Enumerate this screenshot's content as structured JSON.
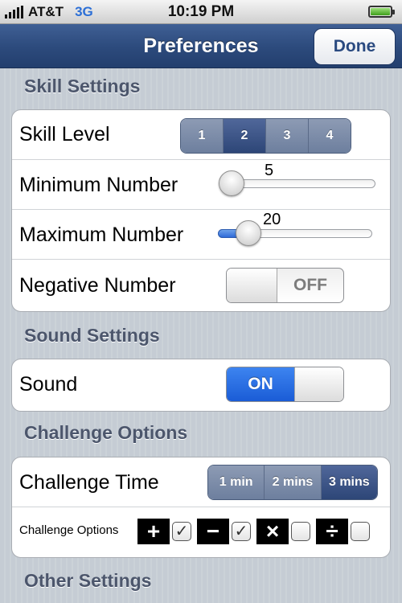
{
  "status_bar": {
    "carrier": "AT&T",
    "network": "3G",
    "time": "10:19 PM",
    "battery_level": 1.0
  },
  "nav": {
    "title": "Preferences",
    "done_label": "Done"
  },
  "sections": {
    "skill": "Skill Settings",
    "sound": "Sound Settings",
    "challenge": "Challenge Options",
    "other": "Other Settings"
  },
  "skill": {
    "level_label": "Skill Level",
    "levels": [
      "1",
      "2",
      "3",
      "4"
    ],
    "selected_level": "2",
    "min_label": "Minimum Number",
    "min_value": "5",
    "min_fraction": 0.07,
    "max_label": "Maximum Number",
    "max_value": "20",
    "max_fraction": 0.2,
    "negative_label": "Negative Number",
    "negative_state": "OFF"
  },
  "sound": {
    "label": "Sound",
    "state": "ON"
  },
  "challenge": {
    "time_label": "Challenge Time",
    "times": [
      "1 min",
      "2 mins",
      "3 mins"
    ],
    "selected_time": "3 mins",
    "options_label": "Challenge Options",
    "ops": [
      {
        "name": "plus",
        "symbol": "+",
        "checked": true,
        "mark": "✓"
      },
      {
        "name": "minus",
        "symbol": "−",
        "checked": true,
        "mark": "✓"
      },
      {
        "name": "times",
        "symbol": "×",
        "checked": false,
        "mark": ""
      },
      {
        "name": "divide",
        "symbol": "÷",
        "checked": false,
        "mark": ""
      }
    ]
  },
  "colors": {
    "nav_blue": "#2c4a7c",
    "selected_segment": "#2d4677",
    "switch_on": "#1a5cd6",
    "background": "#c5ccd4"
  }
}
